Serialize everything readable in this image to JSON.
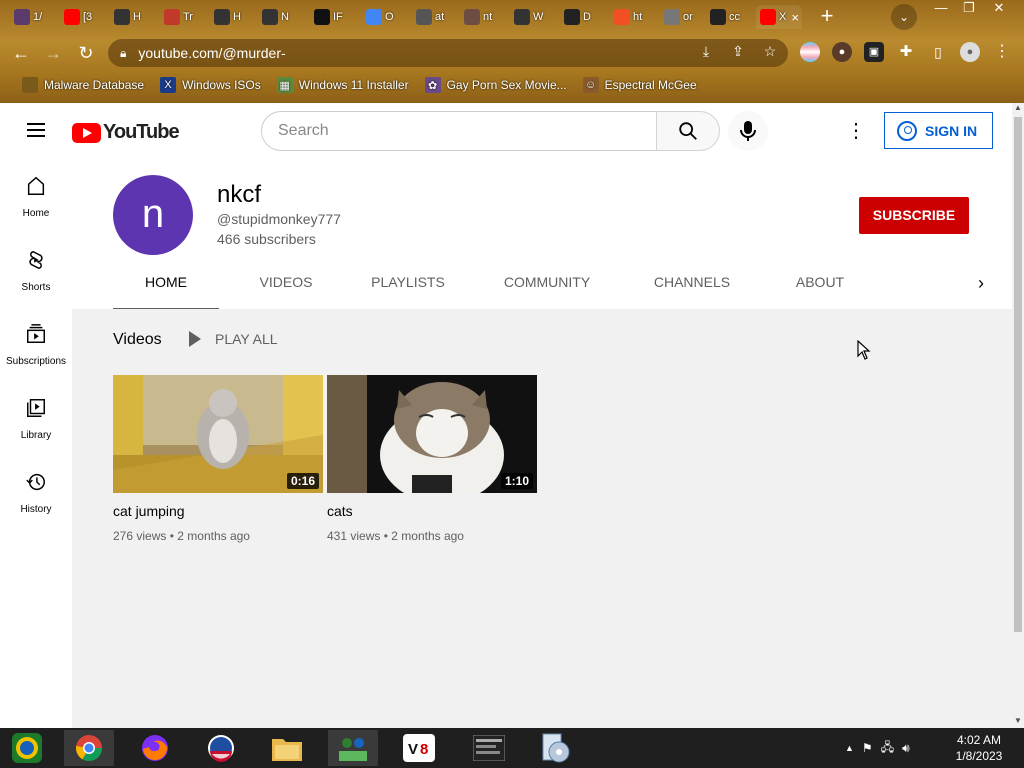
{
  "browser": {
    "tabs": [
      {
        "title": "1/",
        "color": "#5a3b6b"
      },
      {
        "title": "[3",
        "color": "#ff0000"
      },
      {
        "title": "H",
        "color": "#333333"
      },
      {
        "title": "Tr",
        "color": "#c0392b"
      },
      {
        "title": "H",
        "color": "#333333"
      },
      {
        "title": "N",
        "color": "#333333"
      },
      {
        "title": "IF",
        "color": "#111111"
      },
      {
        "title": "O",
        "color": "#4285f4"
      },
      {
        "title": "at",
        "color": "#555555"
      },
      {
        "title": "nt",
        "color": "#6d4c41"
      },
      {
        "title": "W",
        "color": "#333333"
      },
      {
        "title": "D",
        "color": "#222222"
      },
      {
        "title": "ht",
        "color": "#f25022"
      },
      {
        "title": "or",
        "color": "#777777"
      },
      {
        "title": "cc",
        "color": "#222222"
      },
      {
        "title": "X",
        "color": "#ff0000"
      }
    ],
    "new_tab": "+",
    "url": "youtube.com/@murder-",
    "bookmarks": [
      {
        "label": "Malware Database",
        "icon": "",
        "color": "#7a5a1a"
      },
      {
        "label": "Windows ISOs",
        "icon": "X",
        "color": "#1a3a8a"
      },
      {
        "label": "Windows 11 Installer",
        "icon": "▦",
        "color": "#5a8a3a"
      },
      {
        "label": "Gay Porn Sex Movie...",
        "icon": "✿",
        "color": "#6a4a8a"
      },
      {
        "label": "Espectral McGee",
        "icon": "☺",
        "color": "#8a5a2a"
      }
    ]
  },
  "youtube": {
    "logo_text": "YouTube",
    "search_placeholder": "Search",
    "sign_in": "SIGN IN",
    "guide": [
      {
        "label": "Home"
      },
      {
        "label": "Shorts"
      },
      {
        "label": "Subscriptions"
      },
      {
        "label": "Library"
      },
      {
        "label": "History"
      }
    ],
    "channel": {
      "avatar_letter": "n",
      "name": "nkcf",
      "handle": "@stupidmonkey777",
      "subscribers": "466 subscribers",
      "subscribe_label": "SUBSCRIBE",
      "avatar_color": "#5e35b1"
    },
    "tabs": [
      "HOME",
      "VIDEOS",
      "PLAYLISTS",
      "COMMUNITY",
      "CHANNELS",
      "ABOUT"
    ],
    "section_title": "Videos",
    "play_all": "PLAY ALL",
    "videos": [
      {
        "title": "cat jumping",
        "views": "276 views",
        "age": "2 months ago",
        "duration": "0:16"
      },
      {
        "title": "cats",
        "views": "431 views",
        "age": "2 months ago",
        "duration": "1:10"
      }
    ]
  },
  "taskbar": {
    "time": "4:02 AM",
    "date": "1/8/2023",
    "apps": [
      "windows-logo",
      "chrome",
      "firefox",
      "obama-logo",
      "file-explorer",
      "network-people",
      "vs-app",
      "terminal-warning",
      "disc-app"
    ]
  }
}
